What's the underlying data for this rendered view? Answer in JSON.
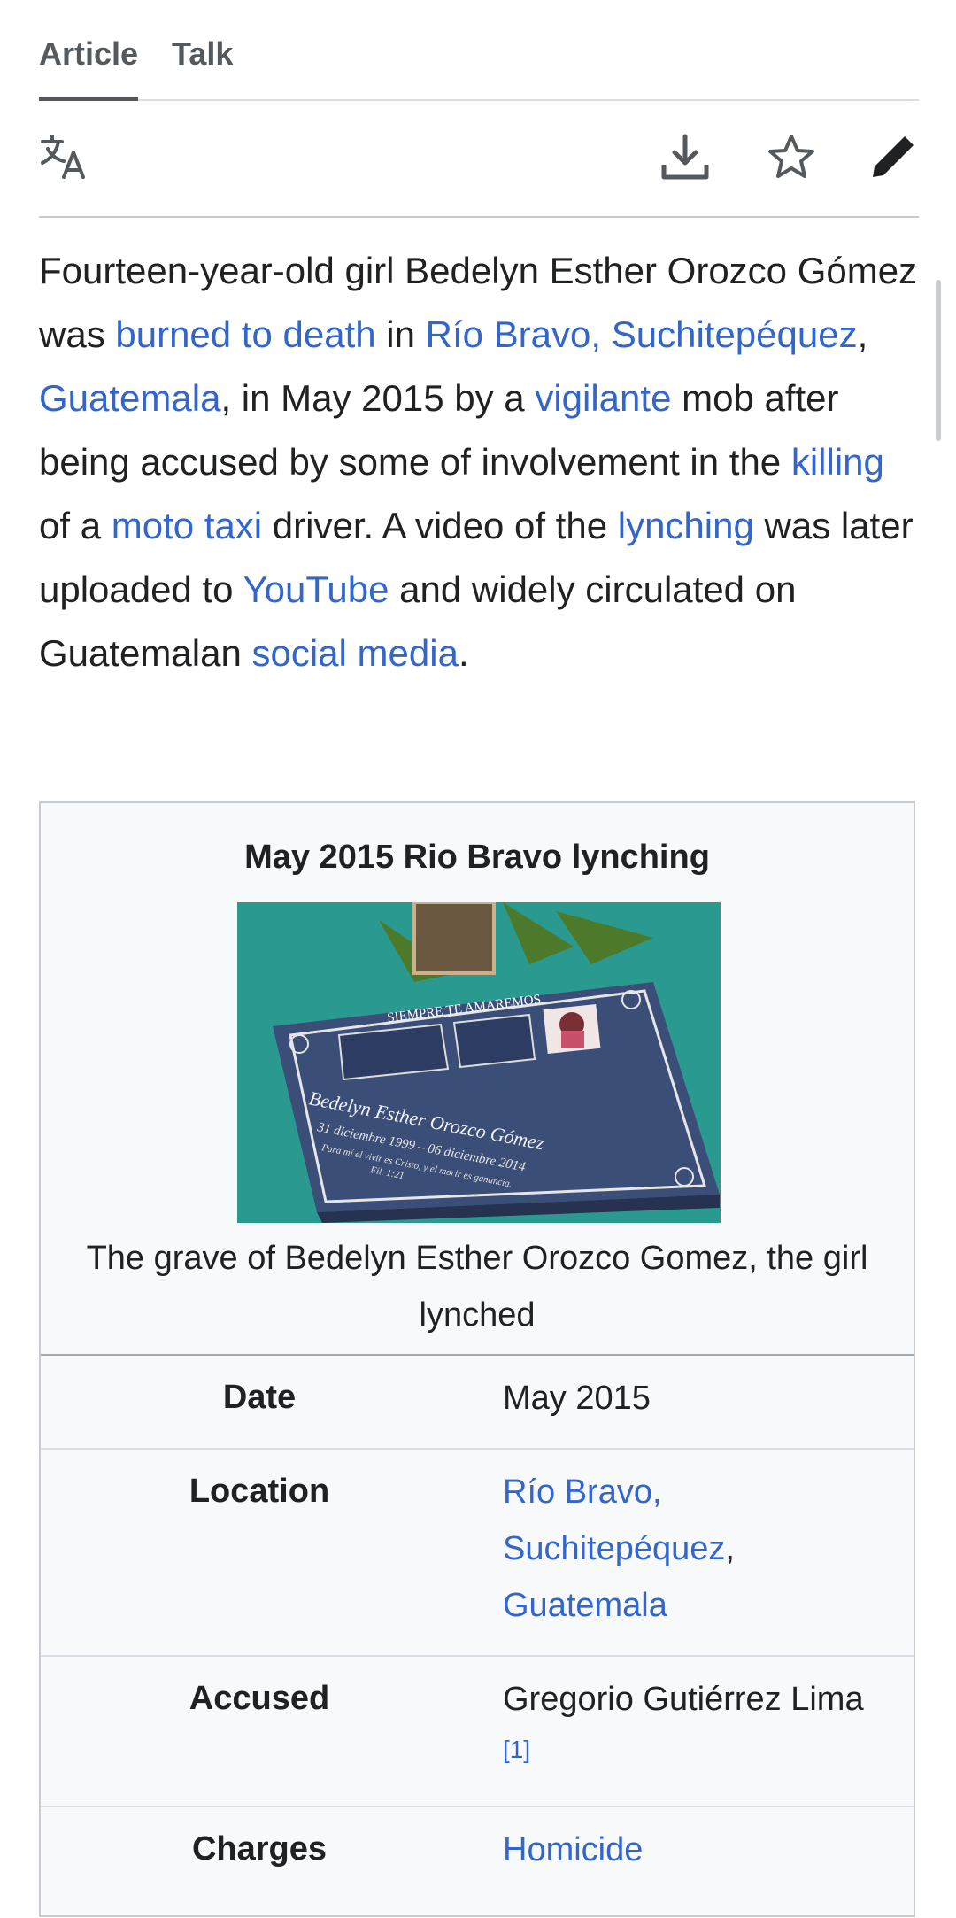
{
  "tabs": [
    {
      "label": "Article",
      "active": true
    },
    {
      "label": "Talk",
      "active": false
    }
  ],
  "toolbar": {
    "icons": [
      "translate-icon",
      "download-icon",
      "star-icon",
      "edit-pencil-icon"
    ]
  },
  "lead": {
    "t1": "Fourteen-year-old girl Bedelyn Esther Orozco Gómez was ",
    "l1": "burned to death",
    "t2": " in ",
    "l2": "Río Bravo, Suchitepéquez",
    "t3": ", ",
    "l3": "Guatemala",
    "t4": ", in May 2015 by a ",
    "l4": "vigilante",
    "t5": " mob after being accused by some of involvement in the ",
    "l5": "killing",
    "t6": " of a ",
    "l6": "moto taxi",
    "t7": " driver. A video of the ",
    "l7": "lynching",
    "t8": " was later uploaded to ",
    "l8": "YouTube",
    "t9": " and widely circulated on Guatemalan ",
    "l9": "social media",
    "t10": "."
  },
  "infobox": {
    "title": "May 2015 Rio Bravo lynching",
    "image_plaque_header": "SIEMPRE TE AMAREMOS",
    "image_plaque_name": "Bedelyn Esther Orozco Gómez",
    "image_plaque_dates": "31 diciembre 1999 – 06 diciembre 2014",
    "image_plaque_verse": "Para mí el vivir es Cristo, y el morir es ganancia.",
    "image_plaque_ref": "Fil. 1:21",
    "caption": "The grave of Bedelyn Esther Orozco Gomez, the girl lynched",
    "rows": {
      "date": {
        "label": "Date",
        "value": "May 2015"
      },
      "location": {
        "label": "Location",
        "link1": "Río Bravo, Suchitepéquez",
        "sep": ",",
        "link2": "Guatemala"
      },
      "accused": {
        "label": "Accused",
        "value": "Gregorio Gutiérrez Lima",
        "ref": "[1]"
      },
      "charges": {
        "label": "Charges",
        "link": "Homicide"
      }
    }
  },
  "colors": {
    "link": "#3366cc",
    "text": "#202122",
    "infobox_bg": "#f8f9fa",
    "image_bg": "#2ea39a"
  }
}
